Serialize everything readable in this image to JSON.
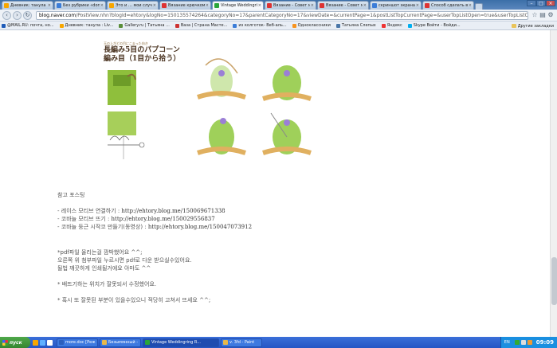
{
  "tabs": [
    {
      "label": "Дневник: танула Liv",
      "color": "#f7a600"
    },
    {
      "label": "Без рубрики «donnal",
      "color": "#3b7dd8"
    },
    {
      "label": "Это и … мои случай",
      "color": "#f7a600"
    },
    {
      "label": "Вязание крючком - но",
      "color": "#d33"
    },
    {
      "label": "Vintage Weddingring R",
      "color": "#2aa53a",
      "active": true
    },
    {
      "label": "Вязание - Совет мод",
      "color": "#d33"
    },
    {
      "label": "Вязание - Совет мод",
      "color": "#d33"
    },
    {
      "label": "скриншот экрана кон",
      "color": "#3b7dd8"
    },
    {
      "label": "Способ сделать в экр",
      "color": "#d33"
    }
  ],
  "url": {
    "host": "blog.naver.com",
    "path": "/PostView.nhn?blogId=ehtory&logNo=150135574264&categoryNo=17&parentCategoryNo=17&viewDate=&currentPage=1&postListTopCurrentPage=&userTopListOpen=true&userTopListC"
  },
  "bookmarks": [
    {
      "label": "@MAIL.RU: почта, но...",
      "color": "#1e5bb8"
    },
    {
      "label": "Дневник: танула : Liv...",
      "color": "#f7a600"
    },
    {
      "label": "Gallery.ru | Татьяна ...",
      "color": "#5a8e3a"
    },
    {
      "label": "Ваза | Страна Масте...",
      "color": "#c33"
    },
    {
      "label": "из колготок- Веб-аль...",
      "color": "#3b7dd8"
    },
    {
      "label": "Одноклассники",
      "color": "#f7931e"
    },
    {
      "label": "Татьяна Слепых",
      "color": "#4a76a8"
    },
    {
      "label": "Яндекс",
      "color": "#e33"
    },
    {
      "label": "Skype Войти - Войди...",
      "color": "#00aff0"
    }
  ],
  "other_bookmarks": "Другие закладки",
  "figure": {
    "title_sub": "玉の上がどの目にこまった向き",
    "title_main_1": "長編み5目のパプコーン",
    "title_main_2": "編み目（1目から拾う）"
  },
  "post": {
    "heading": "참고 포스팅",
    "links": [
      {
        "prefix": "- 레이스 모티브 연결하기 : ",
        "url": "http://ehtory.blog.me/150069671338"
      },
      {
        "prefix": "- 코바늘 모티브 뜨기 : ",
        "url": "http://ehtory.blog.me/150029556837"
      },
      {
        "prefix": "- 코바늘 둥근 시작코 만들기(동영상) : ",
        "url": "http://ehtory.blog.me/150047073912"
      }
    ],
    "note_1": "*pdf파일 올리는걸 깜박했어요 ^^;",
    "note_2": "오른쪽 위 첨부파일 누르시면 pdf로 다운 받으실수있어요.",
    "note_3": "될법 깨끗하게 인쇄될거에요 아마도 ^^",
    "note_4": "* 배뜨기하는 위치가 잘못되서 수정했어요.",
    "note_5": "* 혹시 또 잘못된 부분이 있을수있으니 적당히 고쳐서 뜨세요 ^^;"
  },
  "taskbar": {
    "start": "пуск",
    "buttons": [
      {
        "label": "more.doc [Режим огр...",
        "color": "#2b5fbd"
      },
      {
        "label": "Безымянный - Paint",
        "color": "#e8b84a"
      },
      {
        "label": "Vintage Weddingring R...",
        "color": "#2aa53a",
        "active": true
      },
      {
        "label": "v. 3fd - Paint",
        "color": "#e8b84a"
      }
    ],
    "lang": "EN",
    "clock": "09:09"
  }
}
